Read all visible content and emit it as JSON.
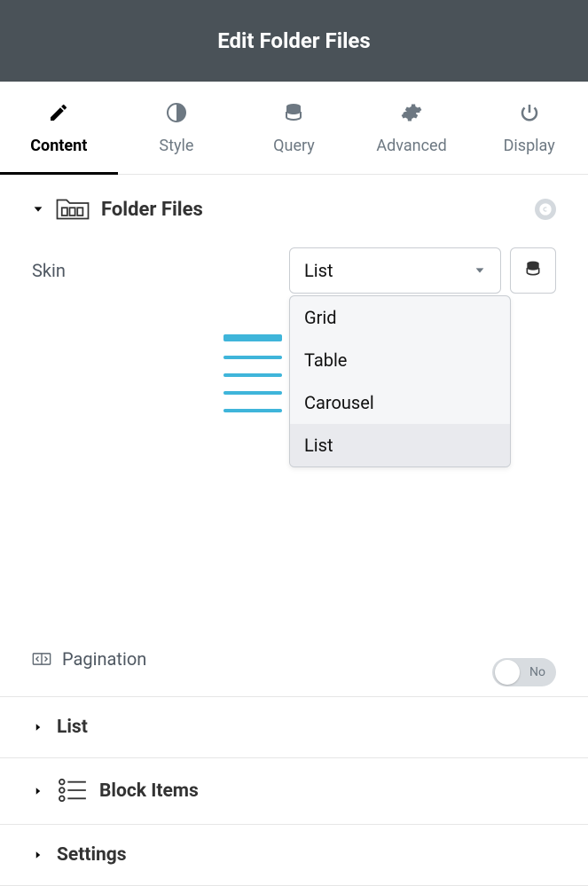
{
  "header": {
    "title": "Edit Folder Files"
  },
  "tabs": [
    {
      "label": "Content",
      "active": true
    },
    {
      "label": "Style",
      "active": false
    },
    {
      "label": "Query",
      "active": false
    },
    {
      "label": "Advanced",
      "active": false
    },
    {
      "label": "Display",
      "active": false
    }
  ],
  "section_folder_files": {
    "title": "Folder Files"
  },
  "skin": {
    "label": "Skin",
    "selected": "List",
    "options": [
      "Grid",
      "Table",
      "Carousel",
      "List"
    ]
  },
  "pagination": {
    "label": "Pagination",
    "state_text": "No"
  },
  "accordions": {
    "list": {
      "title": "List"
    },
    "block_items": {
      "title": "Block Items"
    },
    "settings": {
      "title": "Settings"
    }
  }
}
